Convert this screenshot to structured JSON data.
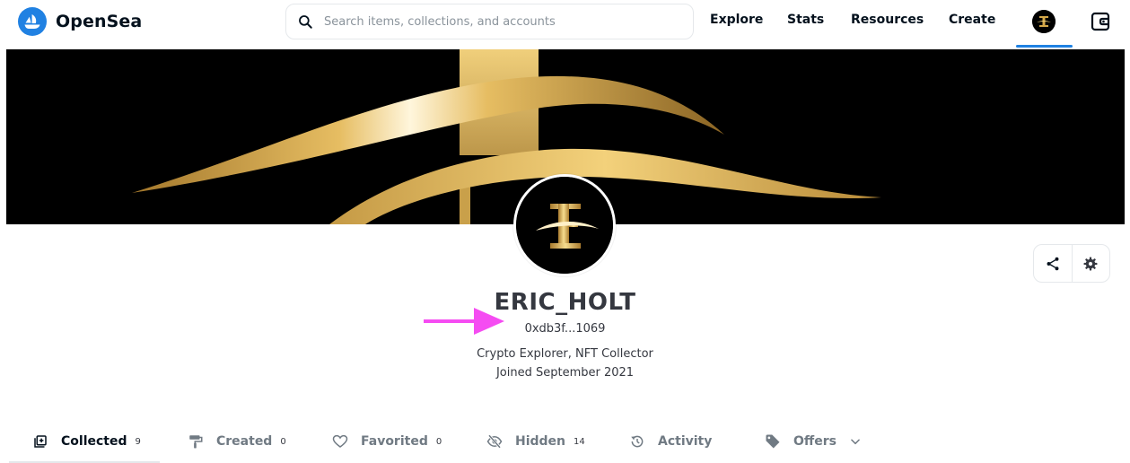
{
  "header": {
    "brand_name": "OpenSea",
    "search_placeholder": "Search items, collections, and accounts",
    "nav": [
      {
        "label": "Explore"
      },
      {
        "label": "Stats"
      },
      {
        "label": "Resources"
      },
      {
        "label": "Create"
      }
    ],
    "icons": {
      "logo": "opensea-logo-icon",
      "search": "search-icon",
      "profile": "profile-avatar-icon",
      "wallet": "wallet-icon"
    }
  },
  "profile": {
    "username": "ERIC_HOLT",
    "address": "0xdb3f...1069",
    "bio": "Crypto Explorer, NFT Collector",
    "joined": "Joined September 2021",
    "actions": [
      {
        "icon": "share-icon"
      },
      {
        "icon": "gear-icon"
      }
    ],
    "annotation_arrow_color": "#f54cf2"
  },
  "tabs": [
    {
      "label": "Collected",
      "count": "9",
      "icon": "collected-icon",
      "active": true
    },
    {
      "label": "Created",
      "count": "0",
      "icon": "paint-roller-icon"
    },
    {
      "label": "Favorited",
      "count": "0",
      "icon": "heart-icon"
    },
    {
      "label": "Hidden",
      "count": "14",
      "icon": "eye-slash-icon"
    },
    {
      "label": "Activity",
      "count": "",
      "icon": "history-icon"
    },
    {
      "label": "Offers",
      "count": "",
      "icon": "tag-icon",
      "dropdown_icon": "chevron-down-icon"
    }
  ],
  "colors": {
    "brand_blue": "#2081e2",
    "text_dark": "#04111d",
    "text_muted": "#707a83",
    "gold": "#d4a84a",
    "arrow_magenta": "#f54cf2"
  }
}
